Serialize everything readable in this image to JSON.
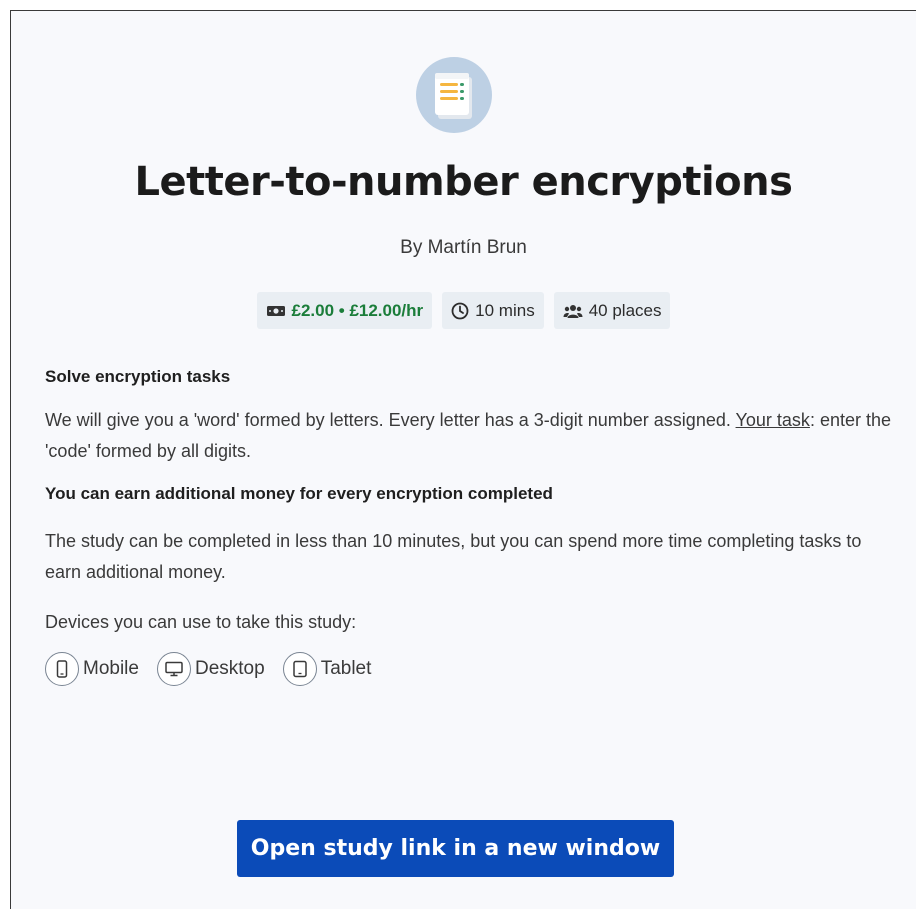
{
  "study": {
    "title": "Letter-to-number encryptions",
    "author": "By Martín Brun",
    "logo_icon": "document-list-icon"
  },
  "chips": {
    "reward": "£2.00 • £12.00/hr",
    "duration": "10 mins",
    "places": "40 places"
  },
  "description": {
    "heading1": "Solve encryption tasks",
    "para1_main": "We will give you a 'word' formed by letters. Every letter has a 3-digit number assigned.",
    "para1_task_label": "Your task",
    "para1_task_rest": ": enter the 'code' formed by all digits.",
    "heading2": "You can earn additional money for every encryption completed",
    "para2": "The study can be completed in less than 10 minutes, but you can spend more time completing tasks to earn additional money.",
    "devices_label": "Devices you can use to take this study:"
  },
  "devices": [
    {
      "label": "Mobile",
      "icon": "mobile-icon"
    },
    {
      "label": "Desktop",
      "icon": "desktop-icon"
    },
    {
      "label": "Tablet",
      "icon": "tablet-icon"
    }
  ],
  "actions": {
    "open_link": "Open study link in a new window"
  },
  "colors": {
    "primary": "#0b4bb8",
    "reward_green": "#1b7d3a",
    "chip_bg": "#e9eef3"
  }
}
